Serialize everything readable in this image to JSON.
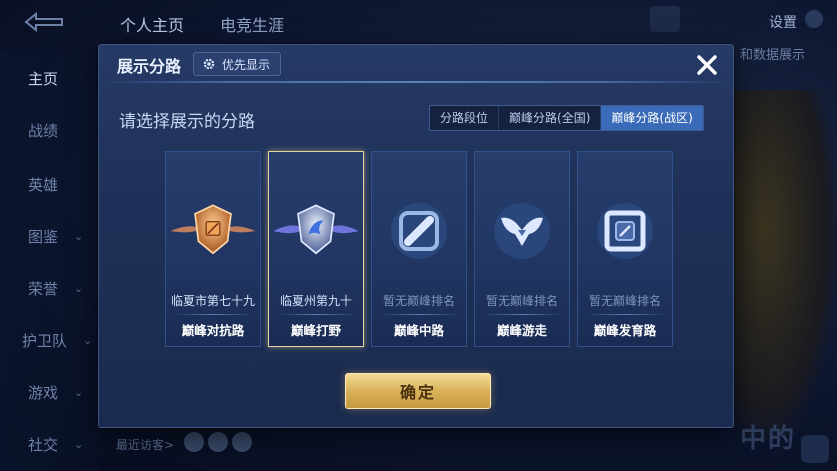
{
  "background": {
    "top_tabs": [
      "个人主页",
      "电竞生涯"
    ],
    "settings_label": "设置",
    "side_nav": [
      {
        "label": "主页",
        "active": true,
        "chevron": false
      },
      {
        "label": "战绩",
        "active": false,
        "chevron": false
      },
      {
        "label": "英雄",
        "active": false,
        "chevron": false
      },
      {
        "label": "图鉴",
        "active": false,
        "chevron": true
      },
      {
        "label": "荣誉",
        "active": false,
        "chevron": true
      },
      {
        "label": "护卫队",
        "active": false,
        "chevron": true
      },
      {
        "label": "游戏",
        "active": false,
        "chevron": true
      },
      {
        "label": "社交",
        "active": false,
        "chevron": true
      }
    ],
    "right_label": "和数据展示",
    "recent_visitors": "最近访客>",
    "bottom_banner": "中的"
  },
  "modal": {
    "title": "展示分路",
    "priority_label": "优先显示",
    "prompt": "请选择展示的分路",
    "tabs": [
      {
        "label": "分路段位",
        "active": false
      },
      {
        "label": "巅峰分路(全国)",
        "active": false
      },
      {
        "label": "巅峰分路(战区)",
        "active": true
      }
    ],
    "cards": [
      {
        "rank": "临夏市第七十九",
        "lane": "巅峰对抗路",
        "emblem": "bronze-shield-emblem",
        "selected": false,
        "ranked": true
      },
      {
        "rank": "临夏州第九十",
        "lane": "巅峰打野",
        "emblem": "silver-shield-emblem",
        "selected": true,
        "ranked": true
      },
      {
        "rank": "暂无巅峰排名",
        "lane": "巅峰中路",
        "emblem": "mid-lane-icon",
        "selected": false,
        "ranked": false
      },
      {
        "rank": "暂无巅峰排名",
        "lane": "巅峰游走",
        "emblem": "roam-icon",
        "selected": false,
        "ranked": false
      },
      {
        "rank": "暂无巅峰排名",
        "lane": "巅峰发育路",
        "emblem": "adc-lane-icon",
        "selected": false,
        "ranked": false
      }
    ],
    "confirm_label": "确定"
  },
  "colors": {
    "accent_blue": "#3a6bb8",
    "confirm_gold": "#d9b25a",
    "selected_border": "#e8d79c"
  }
}
